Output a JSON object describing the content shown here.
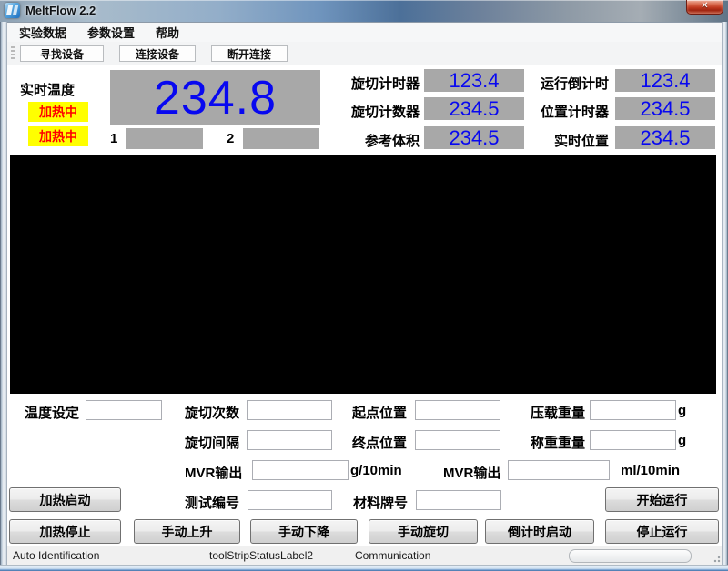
{
  "window": {
    "title": "MeltFlow 2.2",
    "close_glyph": "✕"
  },
  "menu": {
    "items": [
      "实验数据",
      "参数设置",
      "帮助"
    ]
  },
  "toolbar": {
    "buttons": [
      "寻找设备",
      "连接设备",
      "断开连接"
    ]
  },
  "monitor": {
    "temp_label": "实时温度",
    "heating_status_1": "加热中",
    "heating_status_2": "加热中",
    "temperature": "234.8",
    "zone_1": "1",
    "zone_2": "2",
    "readouts": [
      {
        "label": "旋切计时器",
        "value": "123.4"
      },
      {
        "label": "运行倒计时",
        "value": "123.4"
      },
      {
        "label": "旋切计数器",
        "value": "234.5"
      },
      {
        "label": "位置计时器",
        "value": "234.5"
      },
      {
        "label": "参考体积",
        "value": "234.5"
      },
      {
        "label": "实时位置",
        "value": "234.5"
      }
    ]
  },
  "form": {
    "labels": {
      "temp_set": "温度设定",
      "cut_count": "旋切次数",
      "start_pos": "起点位置",
      "load_weight": "压载重量",
      "cut_interval": "旋切间隔",
      "end_pos": "终点位置",
      "weigh_weight": "称重重量",
      "mvr_out_g": "MVR输出",
      "mvr_out_ml": "MVR输出",
      "test_no": "测试编号",
      "material": "材料牌号",
      "unit_g_1": "g",
      "unit_g_2": "g",
      "unit_g10min": "g/10min",
      "unit_ml10min": "ml/10min"
    },
    "values": {
      "temp_set": "",
      "cut_count": "",
      "start_pos": "",
      "load_weight": "",
      "cut_interval": "",
      "end_pos": "",
      "weigh_weight": "",
      "mvr_g": "",
      "mvr_ml": "",
      "test_no": "",
      "material": ""
    }
  },
  "buttons": {
    "heat_start": "加热启动",
    "heat_stop": "加热停止",
    "manual_up": "手动上升",
    "manual_down": "手动下降",
    "manual_cut": "手动旋切",
    "countdown_start": "倒计时启动",
    "run_start": "开始运行",
    "run_stop": "停止运行"
  },
  "statusbar": {
    "left": "Auto Identification",
    "middle": "toolStripStatusLabel2",
    "right": "Communication"
  },
  "colors": {
    "value_blue": "#0808f0",
    "display_gray": "#a8a8a8",
    "heating_yellow": "#ffff00",
    "heating_red": "#ff0000",
    "chart_black": "#000000"
  }
}
